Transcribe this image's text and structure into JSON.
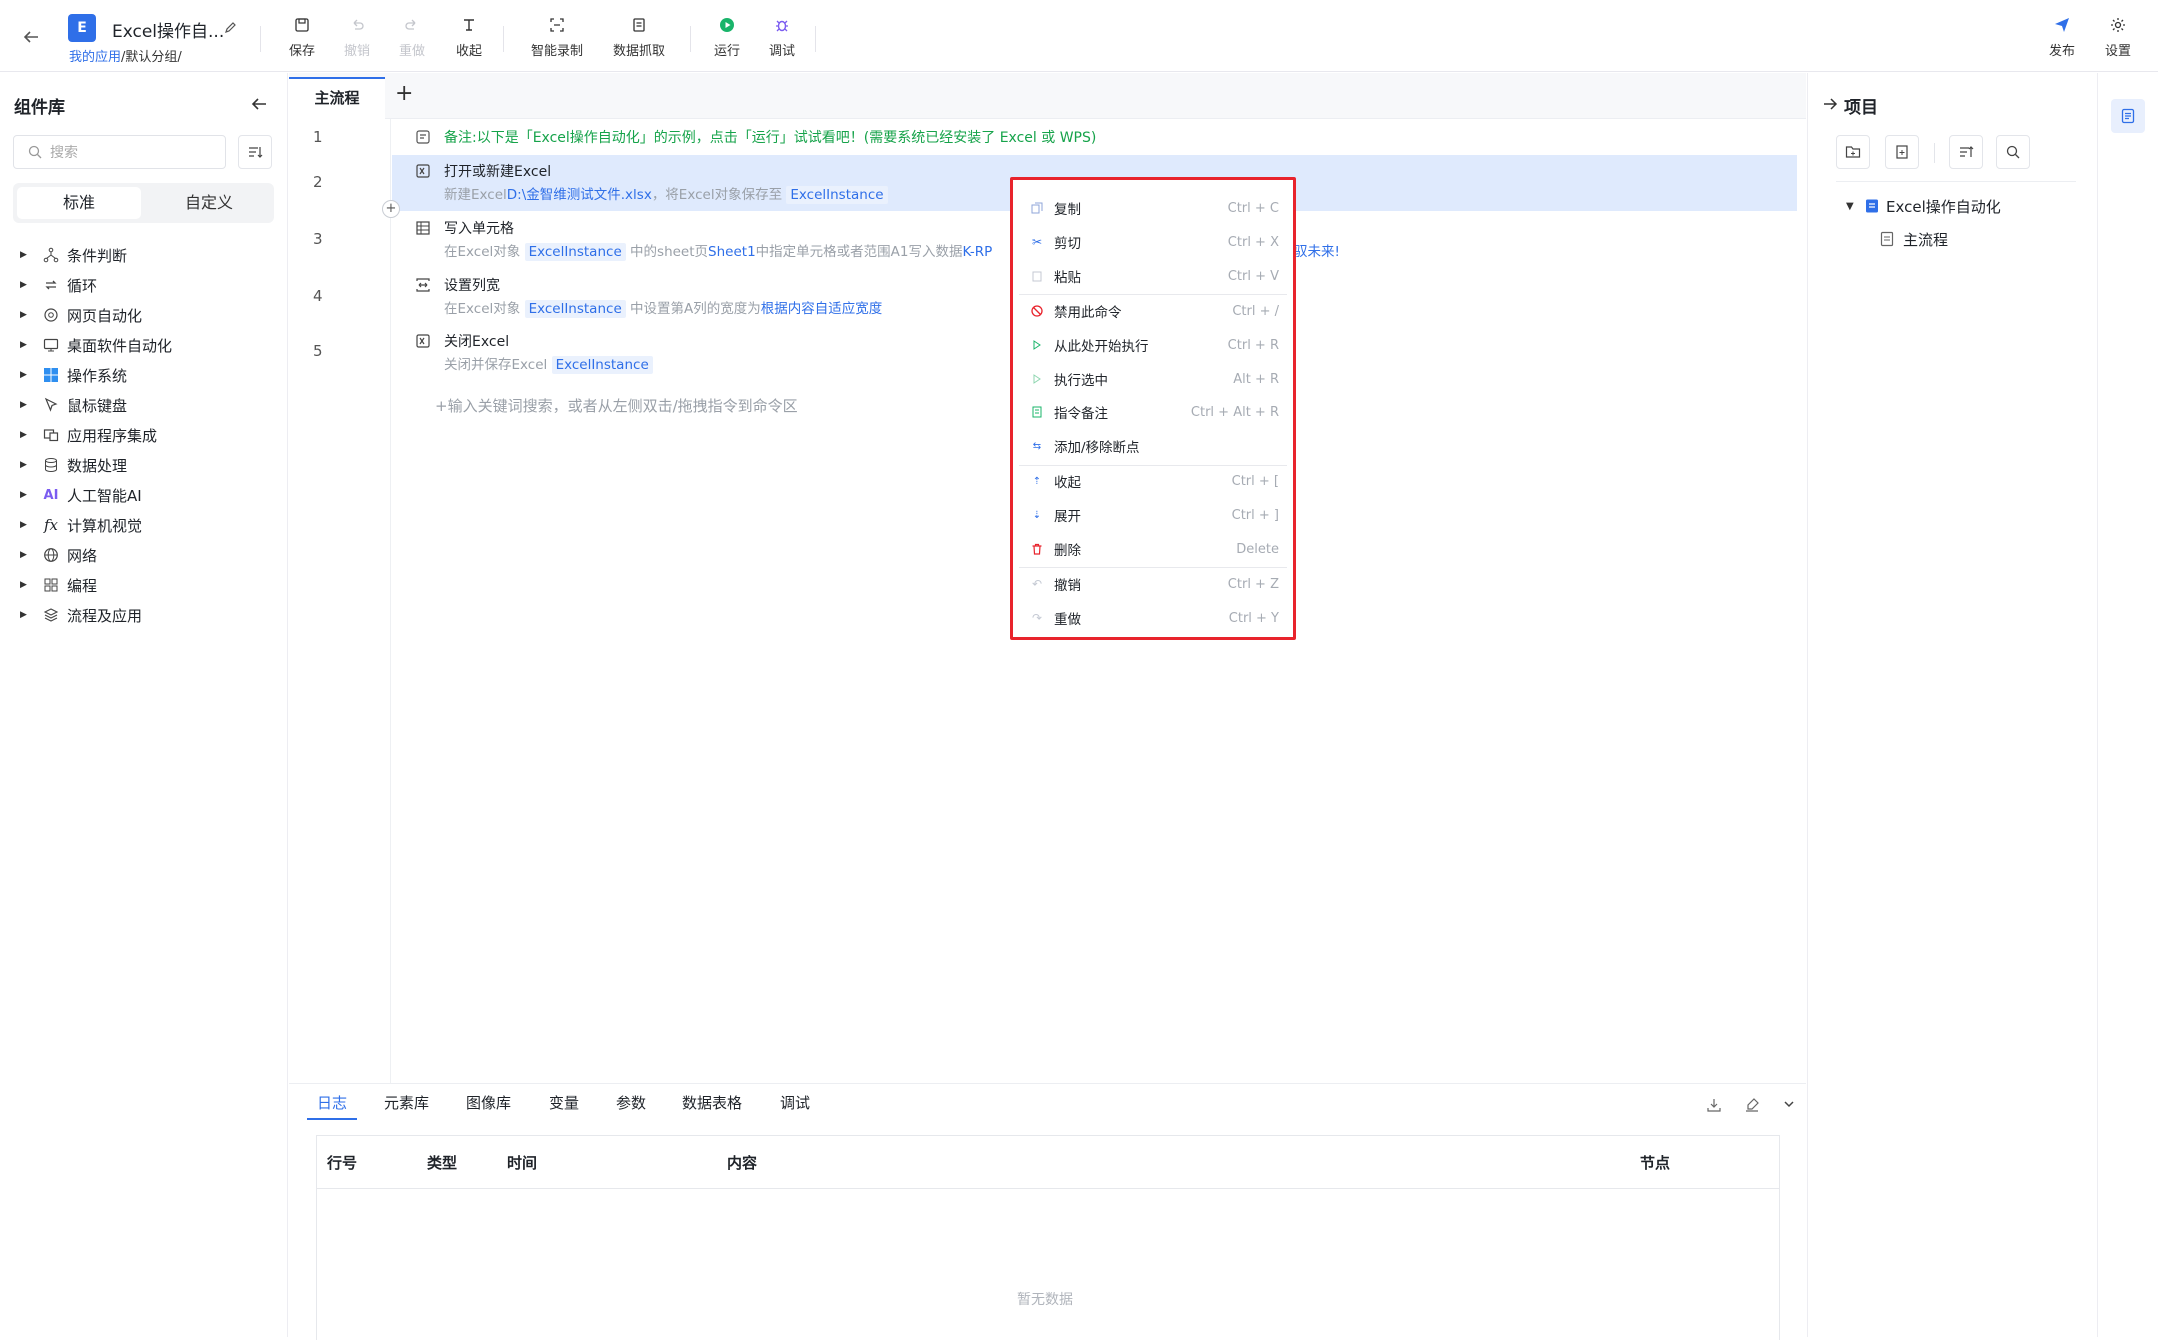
{
  "header": {
    "app_badge": "E",
    "app_title": "Excel操作自...",
    "breadcrumb_link": "我的应用",
    "breadcrumb_rest": "/默认分组/",
    "toolbar": {
      "save": "保存",
      "undo": "撤销",
      "redo": "重做",
      "collapse": "收起",
      "smart_record": "智能录制",
      "data_capture": "数据抓取",
      "run": "运行",
      "debug": "调试",
      "publish": "发布",
      "settings": "设置"
    }
  },
  "left_panel": {
    "title": "组件库",
    "search_placeholder": "搜索",
    "tabs": [
      "标准",
      "自定义"
    ],
    "items": [
      "条件判断",
      "循环",
      "网页自动化",
      "桌面软件自动化",
      "操作系统",
      "鼠标键盘",
      "应用程序集成",
      "数据处理",
      "人工智能AI",
      "计算机视觉",
      "网络",
      "编程",
      "流程及应用"
    ]
  },
  "editor": {
    "tab": "主流程",
    "add_tab": "+",
    "rows": [
      {
        "num": "1",
        "note": "备注:以下是「Excel操作自动化」的示例，点击「运行」试试看吧！(需要系统已经安装了 Excel 或 WPS)"
      },
      {
        "num": "2",
        "title": "打开或新建Excel",
        "d1": "新建Excel",
        "d2": "D:\\金智维测试文件.xlsx",
        "d3": "，将Excel对象保存至 ",
        "d4": "ExcelInstance"
      },
      {
        "num": "3",
        "title": "写入单元格",
        "d1": "在Excel对象 ",
        "d2": "ExcelInstance",
        "d3": " 中的sheet页",
        "d4": "Sheet1",
        "d5": "中指定单元格或者范围A1写入数据",
        "d6": "K-RP",
        "d7": "驭未来!"
      },
      {
        "num": "4",
        "title": "设置列宽",
        "d1": "在Excel对象 ",
        "d2": "ExcelInstance",
        "d3": " 中设置第A列的宽度为",
        "d4": "根据内容自适应宽度"
      },
      {
        "num": "5",
        "title": "关闭Excel",
        "d1": "关闭并保存Excel ",
        "d2": "ExcelInstance"
      }
    ],
    "hint": "+输入关键词搜索，或者从左侧双击/拖拽指令到命令区"
  },
  "context_menu": {
    "items": [
      {
        "label": "复制",
        "shortcut": "Ctrl + C"
      },
      {
        "label": "剪切",
        "shortcut": "Ctrl + X"
      },
      {
        "label": "粘贴",
        "shortcut": "Ctrl + V"
      },
      {
        "label": "禁用此命令",
        "shortcut": "Ctrl + /"
      },
      {
        "label": "从此处开始执行",
        "shortcut": "Ctrl + R"
      },
      {
        "label": "执行选中",
        "shortcut": "Alt + R"
      },
      {
        "label": "指令备注",
        "shortcut": "Ctrl + Alt + R"
      },
      {
        "label": "添加/移除断点",
        "shortcut": ""
      },
      {
        "label": "收起",
        "shortcut": "Ctrl + ["
      },
      {
        "label": "展开",
        "shortcut": "Ctrl + ]"
      },
      {
        "label": "删除",
        "shortcut": "Delete"
      },
      {
        "label": "撤销",
        "shortcut": "Ctrl + Z"
      },
      {
        "label": "重做",
        "shortcut": "Ctrl + Y"
      }
    ]
  },
  "right_panel": {
    "title": "项目",
    "project_name": "Excel操作自动化",
    "flow_name": "主流程"
  },
  "bottom": {
    "tabs": [
      "日志",
      "元素库",
      "图像库",
      "变量",
      "参数",
      "数据表格",
      "调试"
    ],
    "columns": [
      "行号",
      "类型",
      "时间",
      "内容",
      "节点"
    ],
    "empty": "暂无数据"
  },
  "colors": {
    "accent": "#2f6fe8",
    "note_green": "#16a34a",
    "highlight_row": "#dfeafd",
    "menu_border": "#e8232c"
  }
}
